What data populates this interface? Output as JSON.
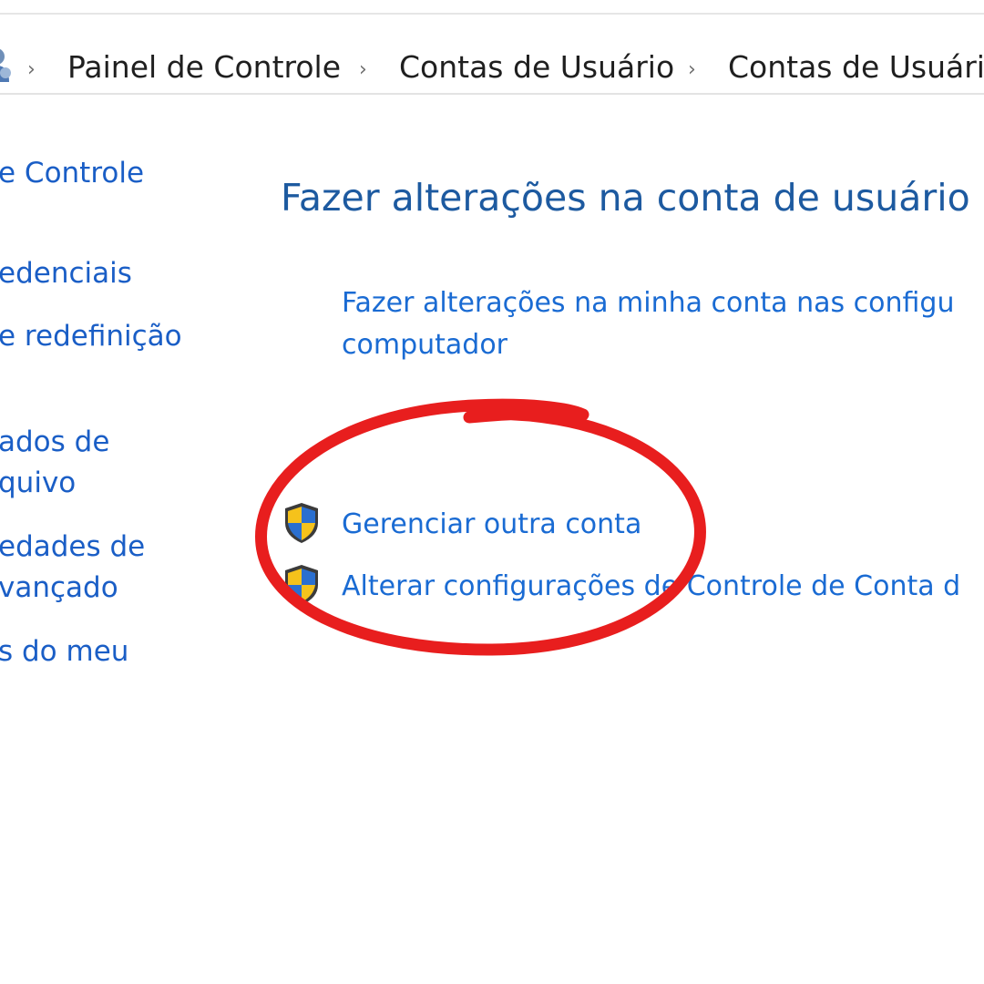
{
  "breadcrumb": {
    "icon": "user-accounts-icon",
    "items": [
      {
        "label": "Painel de Controle"
      },
      {
        "label": "Contas de Usuário"
      },
      {
        "label": "Contas de Usuário"
      }
    ],
    "separator_icon": "chevron-right-icon"
  },
  "sidebar": {
    "items": [
      {
        "label": "e Controle"
      },
      {
        "label": "edenciais"
      },
      {
        "label": "e redefinição"
      },
      {
        "label": "ados de",
        "label2": "quivo"
      },
      {
        "label": "edades de",
        "label2": "vançado"
      },
      {
        "label": "s do meu"
      }
    ]
  },
  "main": {
    "title": "Fazer alterações na conta de usuário",
    "primary_link_line1": "Fazer alterações na minha conta nas configu",
    "primary_link_line2": "computador",
    "tasks": [
      {
        "label": "Gerenciar outra conta",
        "icon": "uac-shield-icon"
      },
      {
        "label": "Alterar configurações de Controle de Conta d",
        "icon": "uac-shield-icon"
      }
    ]
  },
  "annotation": {
    "shape": "ellipse",
    "color": "#e81e1e"
  },
  "colors": {
    "link": "#1a6bd3",
    "title": "#1d5aa0",
    "text": "#1f1f1f"
  }
}
